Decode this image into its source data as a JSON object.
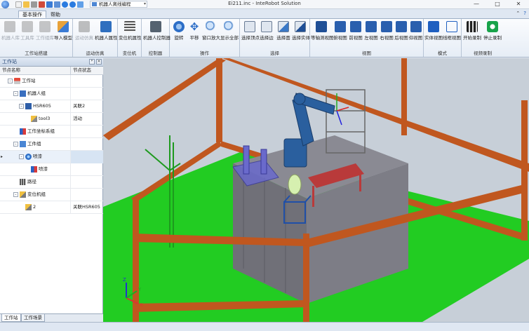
{
  "window": {
    "title": "Ei211.inc - InteRobot Solution",
    "doc_combo": "机器人离线编程",
    "controls": {
      "minimize": "—",
      "maximize": "□",
      "close": "✕"
    }
  },
  "ribbon": {
    "tabs": [
      {
        "label": "基本操作",
        "active": true
      },
      {
        "label": "帮助",
        "active": false
      }
    ],
    "groups": [
      {
        "label": "工作站搭建",
        "buttons": [
          {
            "label": "机器人库",
            "icon": "robot-library-icon",
            "disabled": true
          },
          {
            "label": "工具库",
            "icon": "tool-library-icon",
            "disabled": true
          },
          {
            "label": "工作组库",
            "icon": "workgroup-library-icon",
            "disabled": true
          },
          {
            "label": "导入模型",
            "icon": "import-model-icon",
            "disabled": false
          }
        ]
      },
      {
        "label": "运动仿真",
        "buttons": [
          {
            "label": "运动仿真",
            "icon": "motion-sim-icon",
            "disabled": true
          },
          {
            "label": "机器人属性",
            "icon": "robot-properties-icon",
            "disabled": false
          }
        ]
      },
      {
        "label": "变位机",
        "buttons": [
          {
            "label": "变位机属性",
            "icon": "positioner-properties-icon",
            "disabled": false
          }
        ]
      },
      {
        "label": "控制器",
        "buttons": [
          {
            "label": "机器人控制器",
            "icon": "robot-controller-icon",
            "disabled": false
          }
        ]
      },
      {
        "label": "操作",
        "buttons": [
          {
            "label": "旋转",
            "icon": "rotate-icon",
            "disabled": false
          },
          {
            "label": "平移",
            "icon": "pan-icon",
            "disabled": false
          },
          {
            "label": "窗口放大",
            "icon": "zoom-window-icon",
            "disabled": false
          },
          {
            "label": "显示全部",
            "icon": "zoom-all-icon",
            "disabled": false
          }
        ]
      },
      {
        "label": "选择",
        "buttons": [
          {
            "label": "选择顶点",
            "icon": "select-vertex-icon",
            "disabled": false
          },
          {
            "label": "选择边",
            "icon": "select-edge-icon",
            "disabled": false
          },
          {
            "label": "选择面",
            "icon": "select-face-icon",
            "disabled": false
          },
          {
            "label": "选择实体",
            "icon": "select-solid-icon",
            "disabled": false
          }
        ]
      },
      {
        "label": "视图",
        "buttons": [
          {
            "label": "等轴测视图",
            "icon": "iso-view-icon",
            "disabled": false
          },
          {
            "label": "俯视图",
            "icon": "top-view-icon",
            "disabled": false
          },
          {
            "label": "前视图",
            "icon": "front-view-icon",
            "disabled": false
          },
          {
            "label": "左视图",
            "icon": "left-view-icon",
            "disabled": false
          },
          {
            "label": "右视图",
            "icon": "right-view-icon",
            "disabled": false
          },
          {
            "label": "后视图",
            "icon": "back-view-icon",
            "disabled": false
          },
          {
            "label": "仰视图",
            "icon": "bottom-view-icon",
            "disabled": false
          }
        ]
      },
      {
        "label": "模式",
        "buttons": [
          {
            "label": "实体视图",
            "icon": "solid-mode-icon",
            "disabled": false
          },
          {
            "label": "线框视图",
            "icon": "wireframe-mode-icon",
            "disabled": false
          }
        ]
      },
      {
        "label": "视频录制",
        "buttons": [
          {
            "label": "开始录制",
            "icon": "record-start-icon",
            "disabled": false
          },
          {
            "label": "停止录制",
            "icon": "record-stop-icon",
            "disabled": false
          }
        ]
      }
    ]
  },
  "panel": {
    "title": "工作站",
    "pin": "ᵖ",
    "close": "×",
    "columns": [
      "节点名称",
      "节点状态"
    ],
    "nodes": [
      {
        "label": "工作站",
        "status": "",
        "expander": "-",
        "icon": "workstation-icon",
        "level": 0
      },
      {
        "label": "机器人组",
        "status": "",
        "expander": "-",
        "icon": "robot-group-icon",
        "level": 1
      },
      {
        "label": "HSR605",
        "status": "关联2",
        "expander": "-",
        "icon": "robot-icon",
        "level": 2
      },
      {
        "label": "tool3",
        "status": "活动",
        "expander": "",
        "icon": "tool-icon",
        "level": 3
      },
      {
        "label": "工作坐标系组",
        "status": "",
        "expander": "",
        "icon": "frame-group-icon",
        "level": 1
      },
      {
        "label": "工件组",
        "status": "",
        "expander": "-",
        "icon": "workpiece-group-icon",
        "level": 1
      },
      {
        "label": "喷漆",
        "status": "",
        "expander": "-",
        "icon": "workpiece-icon",
        "level": 2,
        "selected": true
      },
      {
        "label": "喷漆",
        "status": "",
        "expander": "",
        "icon": "frame-icon",
        "level": 3
      },
      {
        "label": "路径",
        "status": "",
        "expander": "",
        "icon": "path-icon",
        "level": 1
      },
      {
        "label": "变位机组",
        "status": "",
        "expander": "-",
        "icon": "positioner-group-icon",
        "level": 1
      },
      {
        "label": "2",
        "status": "关联HSR605",
        "expander": "",
        "icon": "positioner-icon",
        "level": 2
      }
    ],
    "tabs": [
      {
        "label": "工作站",
        "active": true
      },
      {
        "label": "工作场景",
        "active": false
      }
    ]
  },
  "scene": {
    "axis_labels": {
      "x": "X",
      "y": "Y",
      "z": "Z"
    },
    "colors": {
      "background": "#c7cfd8",
      "floor": "#22cc22",
      "frame": "#c0571f",
      "table": "#7a7a82",
      "robot": "#2a5f9e",
      "desk": "#b93a3a"
    }
  }
}
